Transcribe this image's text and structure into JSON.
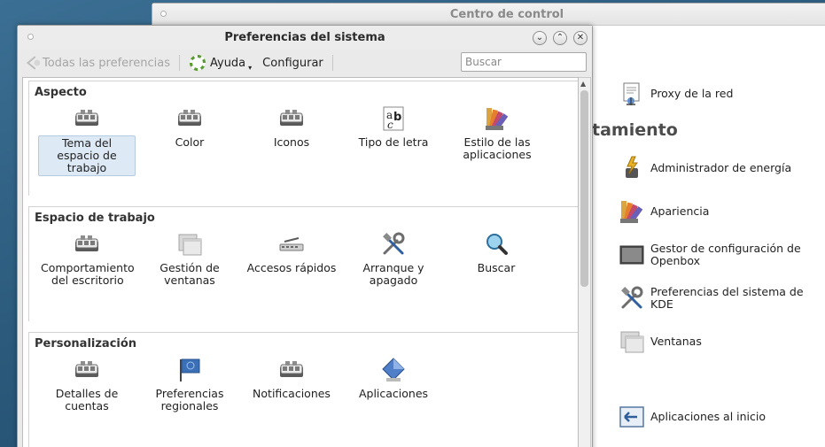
{
  "control_center": {
    "title": "Centro de control",
    "heading": "tamiento",
    "items": [
      {
        "label": "Proxy de la red",
        "icon": "network-proxy-icon"
      },
      {
        "label": "Administrador de energía",
        "icon": "power-manager-icon"
      },
      {
        "label": "Apariencia",
        "icon": "appearance-icon"
      },
      {
        "label": "Gestor de configuración de Openbox",
        "icon": "openbox-config-icon"
      },
      {
        "label": "Preferencias del sistema de KDE",
        "icon": "kde-tools-icon"
      },
      {
        "label": "Ventanas",
        "icon": "windows-icon"
      },
      {
        "label": "Aplicaciones al inicio",
        "icon": "startup-apps-icon"
      }
    ]
  },
  "system_prefs": {
    "title": "Preferencias del sistema",
    "window_buttons": {
      "minimize": "⌄",
      "maximize": "⌃",
      "close": "✕"
    },
    "toolbar": {
      "all_prefs_label": "Todas las preferencias",
      "help_label": "Ayuda",
      "configure_label": "Configurar",
      "search_placeholder": "Buscar"
    },
    "sections": [
      {
        "title": "Aspecto",
        "items": [
          {
            "label": "Tema del espacio de trabajo",
            "icon": "workspace-theme-icon",
            "selected": true
          },
          {
            "label": "Color",
            "icon": "color-icon"
          },
          {
            "label": "Iconos",
            "icon": "icons-icon"
          },
          {
            "label": "Tipo de letra",
            "icon": "font-icon"
          },
          {
            "label": "Estilo de las aplicaciones",
            "icon": "app-style-icon"
          }
        ]
      },
      {
        "title": "Espacio de trabajo",
        "items": [
          {
            "label": "Comportamiento del escritorio",
            "icon": "desktop-behavior-icon"
          },
          {
            "label": "Gestión de ventanas",
            "icon": "window-management-icon"
          },
          {
            "label": "Accesos rápidos",
            "icon": "shortcuts-icon"
          },
          {
            "label": "Arranque y apagado",
            "icon": "startup-shutdown-icon"
          },
          {
            "label": "Buscar",
            "icon": "search-icon"
          }
        ]
      },
      {
        "title": "Personalización",
        "items": [
          {
            "label": "Detalles de cuentas",
            "icon": "account-details-icon"
          },
          {
            "label": "Preferencias regionales",
            "icon": "regional-prefs-icon"
          },
          {
            "label": "Notificaciones",
            "icon": "notifications-icon"
          },
          {
            "label": "Aplicaciones",
            "icon": "applications-icon"
          }
        ]
      }
    ]
  }
}
